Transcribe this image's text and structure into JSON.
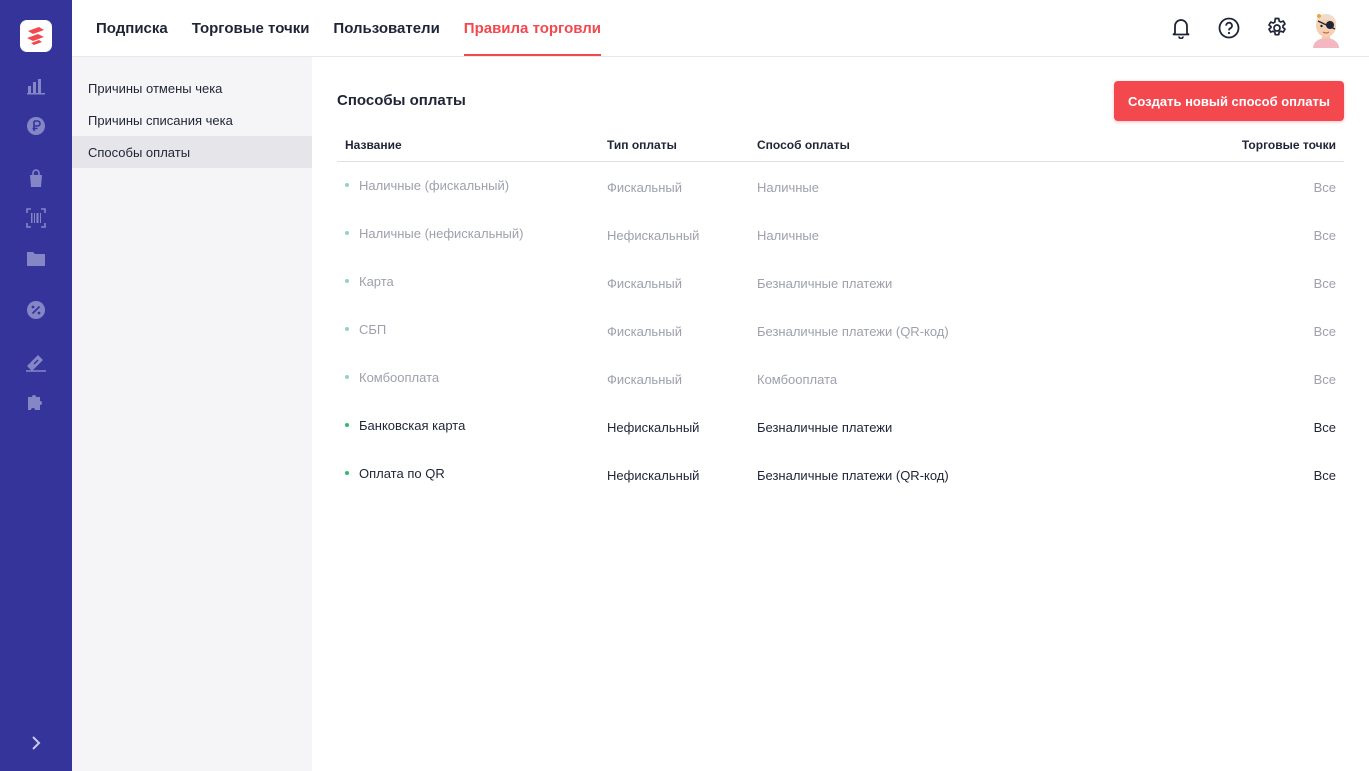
{
  "nav": {
    "tabs": [
      {
        "label": "Подписка",
        "active": false
      },
      {
        "label": "Торговые точки",
        "active": false
      },
      {
        "label": "Пользователи",
        "active": false
      },
      {
        "label": "Правила торговли",
        "active": true
      }
    ],
    "icons": [
      "bell-icon",
      "help-icon",
      "gear-icon",
      "avatar"
    ]
  },
  "rail": {
    "icons": [
      "logo",
      "analytics-icon",
      "ruble-icon",
      "bag-icon",
      "barcode-icon",
      "folder-icon",
      "discount-icon",
      "marketing-icon",
      "puzzle-icon",
      "chevron-right-icon"
    ]
  },
  "subnav": {
    "items": [
      {
        "label": "Причины отмены чека",
        "active": false
      },
      {
        "label": "Причины списания чека",
        "active": false
      },
      {
        "label": "Способы оплаты",
        "active": true
      }
    ]
  },
  "main": {
    "title": "Способы оплаты",
    "create_button": "Создать новый способ оплаты",
    "table": {
      "headers": {
        "name": "Название",
        "type": "Тип оплаты",
        "method": "Способ оплаты",
        "points": "Торговые точки"
      },
      "rows": [
        {
          "name": "Наличные (фискальный)",
          "type": "Фискальный",
          "method": "Наличные",
          "points": "Все",
          "active": false
        },
        {
          "name": "Наличные (нефискальный)",
          "type": "Нефискальный",
          "method": "Наличные",
          "points": "Все",
          "active": false
        },
        {
          "name": "Карта",
          "type": "Фискальный",
          "method": "Безналичные платежи",
          "points": "Все",
          "active": false
        },
        {
          "name": "СБП",
          "type": "Фискальный",
          "method": "Безналичные платежи (QR-код)",
          "points": "Все",
          "active": false
        },
        {
          "name": "Комбооплата",
          "type": "Фискальный",
          "method": "Комбооплата",
          "points": "Все",
          "active": false
        },
        {
          "name": "Банковская карта",
          "type": "Нефискальный",
          "method": "Безналичные платежи",
          "points": "Все",
          "active": true
        },
        {
          "name": "Оплата по QR",
          "type": "Нефискальный",
          "method": "Безналичные платежи (QR-код)",
          "points": "Все",
          "active": true
        }
      ]
    }
  },
  "colors": {
    "rail": "#35349b",
    "accent": "#f2484e",
    "status_dot": "#2dbb74",
    "text": "#1f2437",
    "muted_text": "#9ea1ad"
  }
}
